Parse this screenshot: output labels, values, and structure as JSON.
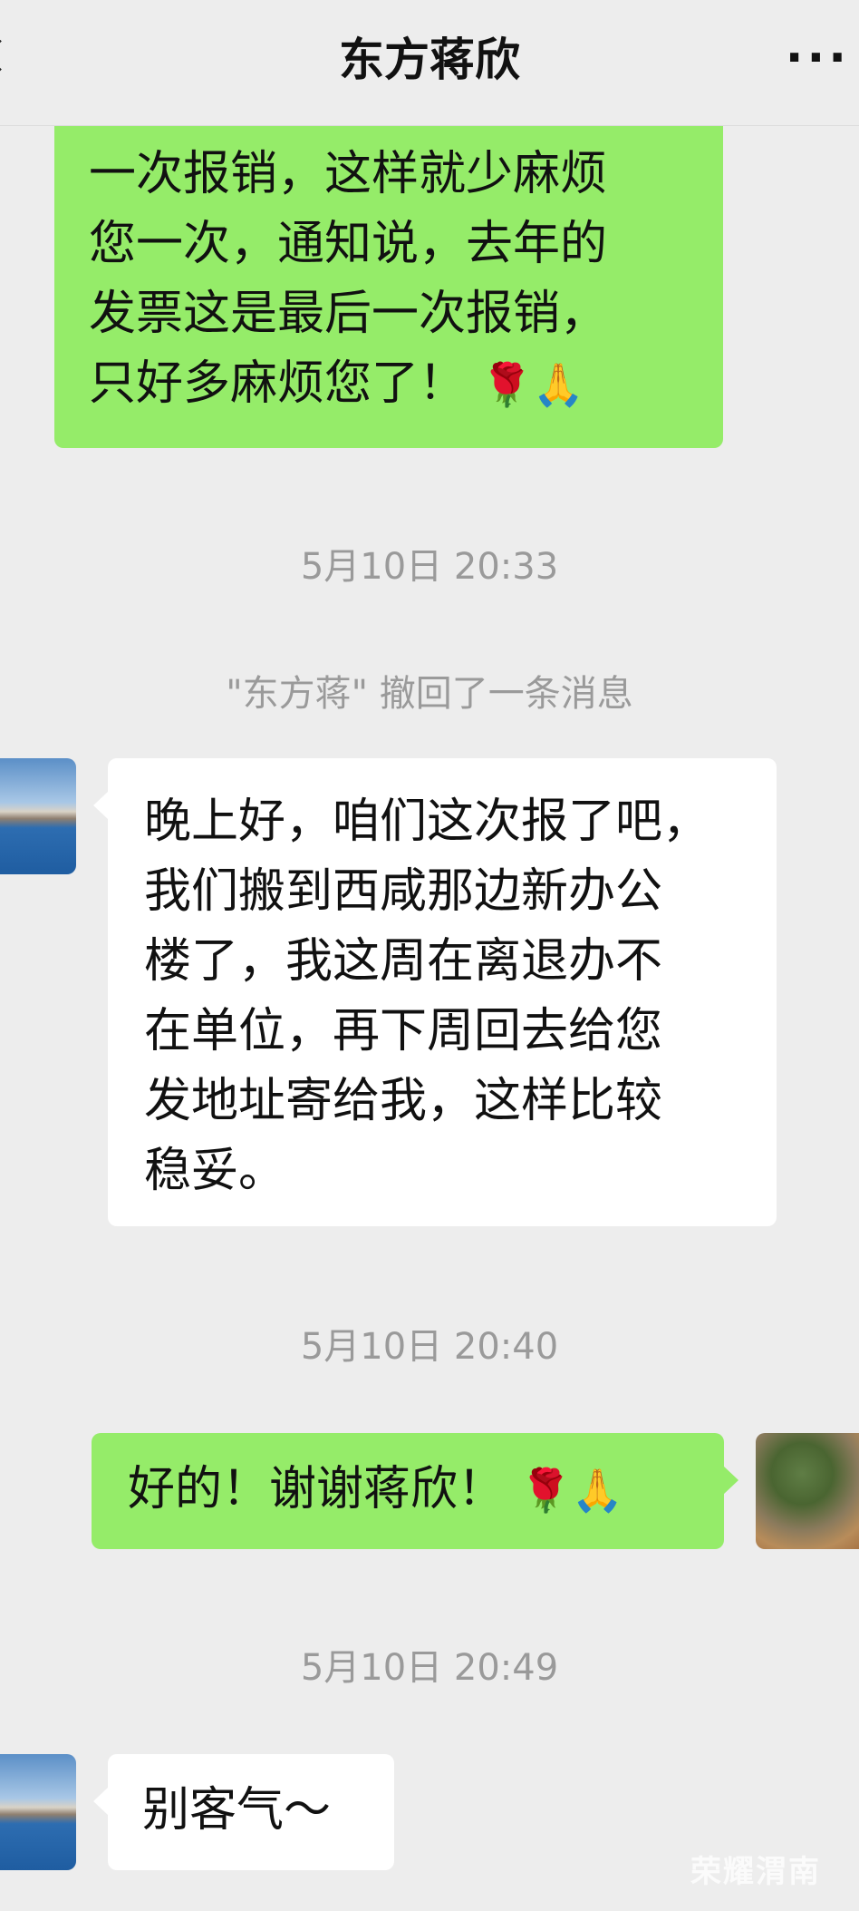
{
  "header": {
    "title": "东方蒋欣",
    "more_icon": "more-icon",
    "back_icon": "back-icon"
  },
  "messages": {
    "m1": {
      "lines": [
        "一次报销，这样就少麻烦",
        "您一次，通知说，去年的",
        "发票这是最后一次报销，",
        "只好多麻烦您了！"
      ],
      "emoji": "🌹🙏"
    },
    "t1": "5月10日 20:33",
    "system": "\"东方蒋\" 撤回了一条消息",
    "m2": {
      "lines": [
        "晚上好，咱们这次报了吧，",
        "我们搬到西咸那边新办公",
        "楼了，我这周在离退办不",
        "在单位，再下周回去给您",
        "发地址寄给我，这样比较",
        "稳妥。"
      ]
    },
    "t2": "5月10日 20:40",
    "m3": {
      "text": "好的！谢谢蒋欣！",
      "emoji": "🌹🙏"
    },
    "t3": "5月10日 20:49",
    "m4": {
      "text": "别客气～"
    }
  },
  "watermark": "荣耀渭南"
}
